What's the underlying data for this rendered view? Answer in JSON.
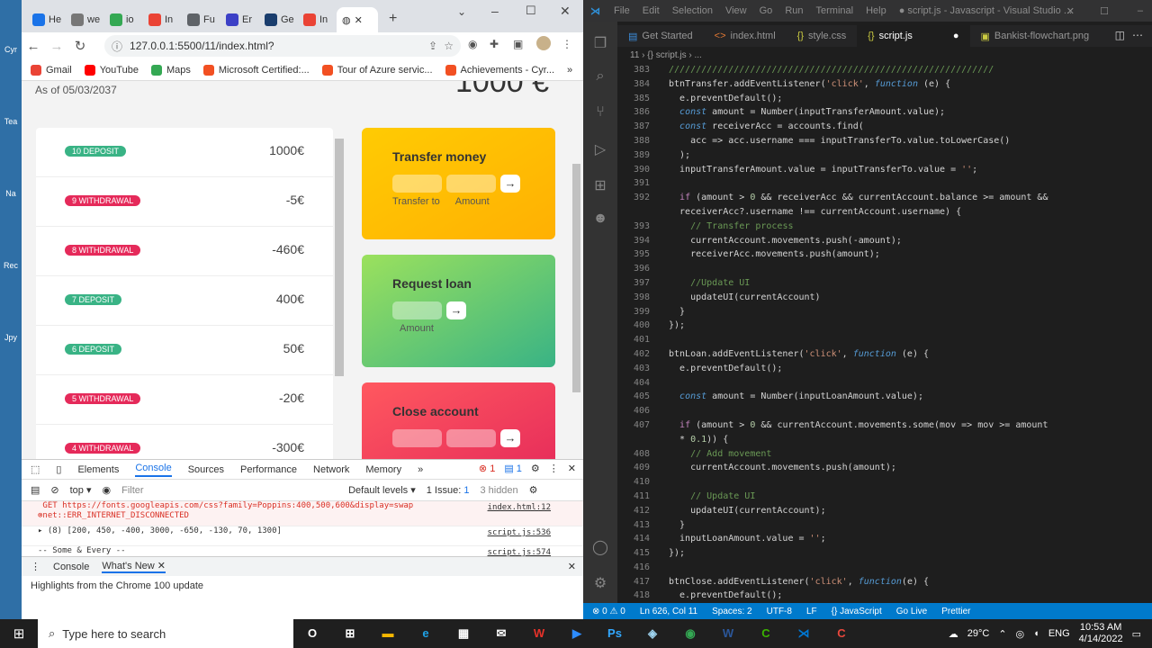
{
  "desktop": {
    "labels": [
      "Cyr",
      "Tea",
      "Na",
      "Rec",
      "Jpy"
    ]
  },
  "browser": {
    "tabs": [
      {
        "label": "He",
        "color": "#1a73e8"
      },
      {
        "label": "we",
        "color": "#777777"
      },
      {
        "label": "io",
        "color": "#34a853"
      },
      {
        "label": "In",
        "color": "#ea4335"
      },
      {
        "label": "Fu",
        "color": "#5f6368"
      },
      {
        "label": "Er",
        "color": "#3c40c6"
      },
      {
        "label": "Ge",
        "color": "#1a3d6d"
      },
      {
        "label": "In",
        "color": "#ea4335"
      }
    ],
    "url": "127.0.0.1:5500/11/index.html?",
    "bookmarks": [
      {
        "label": "Gmail",
        "color": "#ea4335"
      },
      {
        "label": "YouTube",
        "color": "#ff0000"
      },
      {
        "label": "Maps",
        "color": "#34a853"
      },
      {
        "label": "Microsoft Certified:...",
        "color": "#f25022"
      },
      {
        "label": "Tour of Azure servic...",
        "color": "#f25022"
      },
      {
        "label": "Achievements - Cyr...",
        "color": "#f25022"
      }
    ]
  },
  "app": {
    "as_of": "As of 05/03/2037",
    "balance_partial": "1000 €",
    "movements": [
      {
        "type": "10 DEPOSIT",
        "kind": "deposit",
        "amount": "1000€"
      },
      {
        "type": "9 WITHDRAWAL",
        "kind": "withdrawal",
        "amount": "-5€"
      },
      {
        "type": "8 WITHDRAWAL",
        "kind": "withdrawal",
        "amount": "-460€"
      },
      {
        "type": "7 DEPOSIT",
        "kind": "deposit",
        "amount": "400€"
      },
      {
        "type": "6 DEPOSIT",
        "kind": "deposit",
        "amount": "50€"
      },
      {
        "type": "5 WITHDRAWAL",
        "kind": "withdrawal",
        "amount": "-20€"
      },
      {
        "type": "4 WITHDRAWAL",
        "kind": "withdrawal",
        "amount": "-300€"
      }
    ],
    "transfer": {
      "title": "Transfer money",
      "to_label": "Transfer to",
      "amount_label": "Amount",
      "arrow": "→"
    },
    "loan": {
      "title": "Request loan",
      "amount_label": "Amount",
      "arrow": "→"
    },
    "close": {
      "title": "Close account",
      "arrow": "→"
    },
    "colors": {
      "deposit": "#39b385",
      "withdrawal": "#e52a5a",
      "transfer": "#ffb003",
      "loan": "#39b385",
      "close": "#e52a5a"
    }
  },
  "devtools": {
    "tabs": [
      "Elements",
      "Console",
      "Sources",
      "Performance",
      "Network",
      "Memory"
    ],
    "active_tab": "Console",
    "errors": "1",
    "messages": "1",
    "context": "top",
    "filter_placeholder": "Filter",
    "levels": "Default levels",
    "issues": "1 Issue:",
    "issues_count": "1",
    "hidden": "3 hidden",
    "log": [
      {
        "text": "GET https://fonts.googleapis.com/css?family=Poppins:400,500,600&display=swap net::ERR_INTERNET_DISCONNECTED",
        "src": "index.html:12",
        "error": true
      },
      {
        "text": "▸ (8) [200, 450, -400, 3000, -650, -130, 70, 1300]",
        "src": "script.js:536",
        "error": false
      },
      {
        "text": "-- Some & Every --",
        "src": "script.js:574",
        "error": false
      }
    ],
    "drawer_tabs": [
      "Console",
      "What's New"
    ],
    "drawer_text": "Highlights from the Chrome 100 update"
  },
  "vscode": {
    "menu": [
      "File",
      "Edit",
      "Selection",
      "View",
      "Go",
      "Run",
      "Terminal",
      "Help",
      "● script.js - Javascript - Visual Studio ..."
    ],
    "tabs": [
      {
        "label": "Get Started",
        "icon": "▤"
      },
      {
        "label": "index.html",
        "icon": "<>"
      },
      {
        "label": "style.css",
        "icon": "{}"
      },
      {
        "label": "script.js",
        "icon": "{}"
      },
      {
        "label": "Bankist-flowchart.png",
        "icon": "▣"
      }
    ],
    "active_tab": "script.js",
    "breadcrumb": "11 › {} script.js › ...",
    "lines": [
      {
        "n": "383",
        "t": "////////////////////////////////////////////////////////////"
      },
      {
        "n": "384",
        "t": "btnTransfer.addEventListener('click', function (e) {"
      },
      {
        "n": "385",
        "t": "  e.preventDefault();"
      },
      {
        "n": "386",
        "t": "  const amount = Number(inputTransferAmount.value);"
      },
      {
        "n": "387",
        "t": "  const receiverAcc = accounts.find("
      },
      {
        "n": "388",
        "t": "    acc => acc.username === inputTransferTo.value.toLowerCase()"
      },
      {
        "n": "389",
        "t": "  );"
      },
      {
        "n": "390",
        "t": "  inputTransferAmount.value = inputTransferTo.value = '';"
      },
      {
        "n": "391",
        "t": ""
      },
      {
        "n": "392",
        "t": "  if (amount > 0 && receiverAcc && currentAccount.balance >= amount &&"
      },
      {
        "n": "",
        "t": "  receiverAcc?.username !== currentAccount.username) {"
      },
      {
        "n": "393",
        "t": "    // Transfer process"
      },
      {
        "n": "394",
        "t": "    currentAccount.movements.push(-amount);"
      },
      {
        "n": "395",
        "t": "    receiverAcc.movements.push(amount);"
      },
      {
        "n": "396",
        "t": ""
      },
      {
        "n": "397",
        "t": "    //Update UI"
      },
      {
        "n": "398",
        "t": "    updateUI(currentAccount)"
      },
      {
        "n": "399",
        "t": "  }"
      },
      {
        "n": "400",
        "t": "});"
      },
      {
        "n": "401",
        "t": ""
      },
      {
        "n": "402",
        "t": "btnLoan.addEventListener('click', function (e) {"
      },
      {
        "n": "403",
        "t": "  e.preventDefault();"
      },
      {
        "n": "404",
        "t": ""
      },
      {
        "n": "405",
        "t": "  const amount = Number(inputLoanAmount.value);"
      },
      {
        "n": "406",
        "t": ""
      },
      {
        "n": "407",
        "t": "  if (amount > 0 && currentAccount.movements.some(mov => mov >= amount"
      },
      {
        "n": "",
        "t": "  * 0.1)) {"
      },
      {
        "n": "408",
        "t": "    // Add movement"
      },
      {
        "n": "409",
        "t": "    currentAccount.movements.push(amount);"
      },
      {
        "n": "410",
        "t": ""
      },
      {
        "n": "411",
        "t": "    // Update UI"
      },
      {
        "n": "412",
        "t": "    updateUI(currentAccount);"
      },
      {
        "n": "413",
        "t": "  }"
      },
      {
        "n": "414",
        "t": "  inputLoanAmount.value = '';"
      },
      {
        "n": "415",
        "t": "});"
      },
      {
        "n": "416",
        "t": ""
      },
      {
        "n": "417",
        "t": "btnClose.addEventListener('click', function(e) {"
      },
      {
        "n": "418",
        "t": "  e.preventDefault();"
      }
    ],
    "status": [
      "⊗ 0 ⚠ 0",
      "Ln 626, Col 11",
      "Spaces: 2",
      "UTF-8",
      "LF",
      "{} JavaScript",
      "Go Live",
      "Prettier"
    ]
  },
  "taskbar": {
    "search_placeholder": "Type here to search",
    "apps": [
      {
        "label": "O",
        "color": "#ffffff"
      },
      {
        "label": "⊞",
        "color": "#ffffff"
      },
      {
        "label": "▬",
        "color": "#f5b700"
      },
      {
        "label": "e",
        "color": "#1fa1e5"
      },
      {
        "label": "▦",
        "color": "#ffffff"
      },
      {
        "label": "✉",
        "color": "#ffffff"
      },
      {
        "label": "W",
        "color": "#e8322a"
      },
      {
        "label": "▶",
        "color": "#2d8cff"
      },
      {
        "label": "Ps",
        "color": "#31a8ff"
      },
      {
        "label": "◈",
        "color": "#9fd4f0"
      },
      {
        "label": "◉",
        "color": "#34a853"
      },
      {
        "label": "W",
        "color": "#2b579a"
      },
      {
        "label": "C",
        "color": "#3bb300"
      },
      {
        "label": "⋊",
        "color": "#0078d4"
      },
      {
        "label": "C",
        "color": "#e8473c"
      }
    ],
    "weather": "29°C",
    "lang": "ENG",
    "time": "10:53 AM",
    "date": "4/14/2022"
  }
}
